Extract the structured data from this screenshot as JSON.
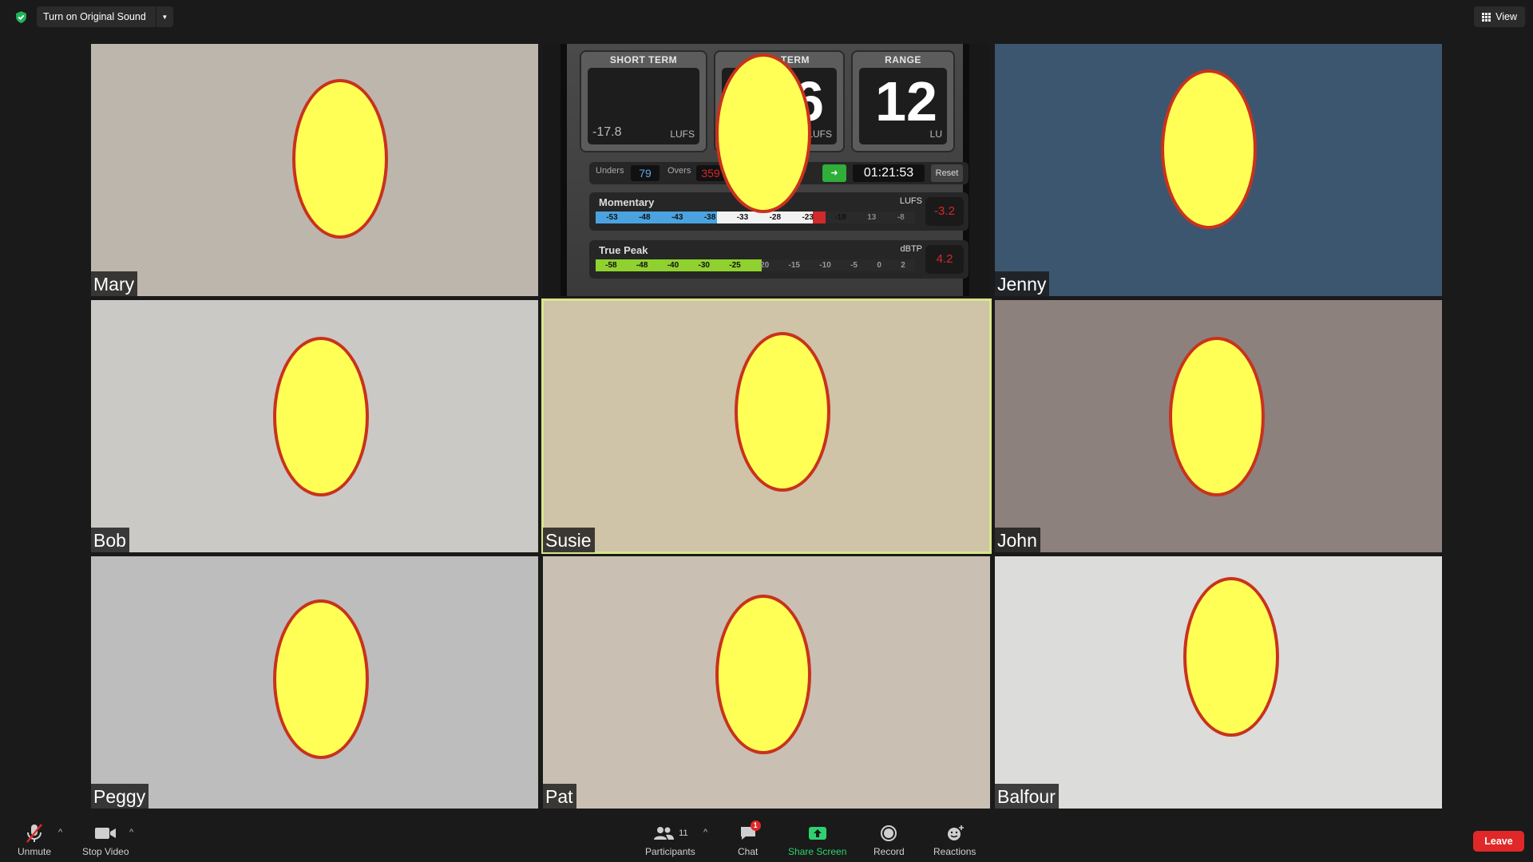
{
  "topbar": {
    "original_sound_label": "Turn on Original Sound",
    "view_label": "View"
  },
  "meter": {
    "short_term": {
      "caption": "SHORT TERM",
      "value": "-17.8",
      "unit": "LUFS"
    },
    "long_term": {
      "caption": "TERM",
      "value": "6",
      "unit": "LUFS"
    },
    "range": {
      "caption": "RANGE",
      "value": "12",
      "unit": "LU"
    },
    "unders_label": "Unders",
    "unders_value": "79",
    "overs_label": "Overs",
    "overs_value": "359",
    "time": "01:21:53",
    "reset_label": "Reset",
    "momentary": {
      "title": "Momentary",
      "unit": "LUFS",
      "readout": "-3.2",
      "ticks": [
        "-53",
        "-48",
        "-43",
        "-38",
        "-33",
        "-28",
        "-23",
        "-18",
        "13",
        "-8"
      ]
    },
    "true_peak": {
      "title": "True Peak",
      "unit": "dBTP",
      "readout": "4.2",
      "ticks": [
        "-58",
        "-48",
        "-40",
        "-30",
        "-25",
        "20",
        "-15",
        "-10",
        "-5",
        "0",
        "2"
      ]
    }
  },
  "participants": [
    {
      "name": "Mary",
      "bg": "#bdb6ad"
    },
    {
      "name": "Jenny",
      "bg": "#3d566f"
    },
    {
      "name": "Bob",
      "bg": "#cbc9c6"
    },
    {
      "name": "Susie",
      "bg": "#cfc3a8"
    },
    {
      "name": "John",
      "bg": "#8d817d"
    },
    {
      "name": "Peggy",
      "bg": "#bdbdbd"
    },
    {
      "name": "Pat",
      "bg": "#c9c0b3"
    },
    {
      "name": "Balfour",
      "bg": "#dcdcda"
    }
  ],
  "toolbar": {
    "unmute": "Unmute",
    "stop_video": "Stop Video",
    "participants": "Participants",
    "participants_count": "11",
    "chat": "Chat",
    "chat_badge": "1",
    "share_screen": "Share Screen",
    "record": "Record",
    "reactions": "Reactions",
    "leave": "Leave"
  },
  "colors": {
    "accent_green": "#2fd16e",
    "leave_red": "#e02828",
    "active_speaker": "#d7e68a",
    "face_fill": "#ffff55",
    "face_border": "#c8321e"
  }
}
